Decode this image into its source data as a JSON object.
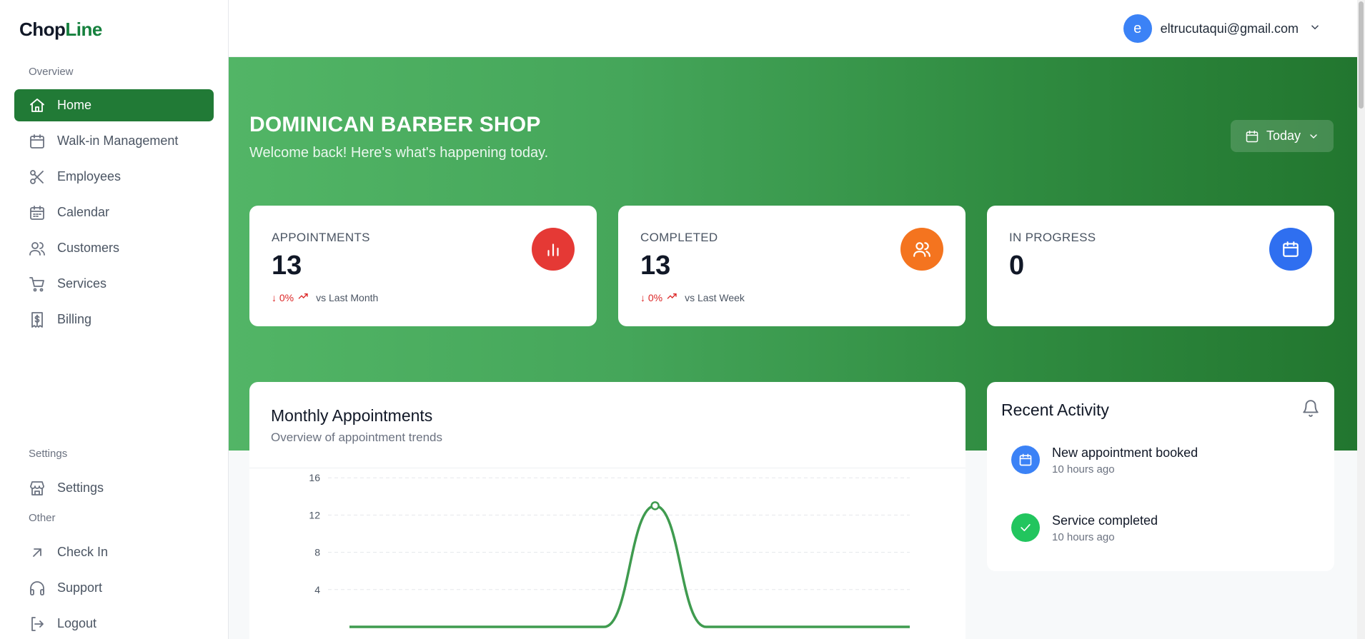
{
  "brand": {
    "part1": "Chop",
    "part2": "Line"
  },
  "sidebar": {
    "overview_label": "Overview",
    "items": [
      {
        "label": "Home",
        "icon": "home-icon"
      },
      {
        "label": "Walk-in Management",
        "icon": "calendar-icon"
      },
      {
        "label": "Employees",
        "icon": "scissors-icon"
      },
      {
        "label": "Calendar",
        "icon": "calendar-days-icon"
      },
      {
        "label": "Customers",
        "icon": "users-icon"
      },
      {
        "label": "Services",
        "icon": "cart-icon"
      },
      {
        "label": "Billing",
        "icon": "receipt-dollar-icon"
      }
    ],
    "settings_label": "Settings",
    "settings_items": [
      {
        "label": "Settings",
        "icon": "store-icon"
      }
    ],
    "other_label": "Other",
    "other_items": [
      {
        "label": "Check In",
        "icon": "arrow-up-right-icon"
      },
      {
        "label": "Support",
        "icon": "headphones-icon"
      },
      {
        "label": "Logout",
        "icon": "logout-icon"
      }
    ]
  },
  "user": {
    "initial": "e",
    "email": "eltrucutaqui@gmail.com"
  },
  "hero": {
    "title": "DOMINICAN BARBER SHOP",
    "subtitle": "Welcome back! Here's what's happening today.",
    "period_button": "Today"
  },
  "stats": [
    {
      "label": "APPOINTMENTS",
      "value": "13",
      "change": "↓ 0%",
      "compare": "vs Last Month",
      "color": "#e53935",
      "icon": "bar-chart-icon"
    },
    {
      "label": "COMPLETED",
      "value": "13",
      "change": "↓ 0%",
      "compare": "vs Last Week",
      "color": "#f4741f",
      "icon": "users-icon"
    },
    {
      "label": "IN PROGRESS",
      "value": "0",
      "color": "#2f6ff0",
      "icon": "calendar-icon"
    }
  ],
  "chart": {
    "title": "Monthly Appointments",
    "subtitle": "Overview of appointment trends"
  },
  "chart_data": {
    "type": "line",
    "title": "Monthly Appointments",
    "y_ticks": [
      4,
      8,
      12,
      16
    ],
    "ylim": [
      0,
      16
    ],
    "x": [
      0,
      1,
      2,
      3,
      4,
      5,
      6,
      7,
      8,
      9,
      10,
      11
    ],
    "series": [
      {
        "values": [
          0,
          0,
          0,
          0,
          0,
          0,
          13,
          0,
          0,
          0,
          0,
          0
        ],
        "color": "#3f9b4f"
      }
    ],
    "grid": true
  },
  "activity": {
    "title": "Recent Activity",
    "items": [
      {
        "title": "New appointment booked",
        "time": "10 hours ago",
        "color": "#3b82f6",
        "icon": "calendar-icon"
      },
      {
        "title": "Service completed",
        "time": "10 hours ago",
        "color": "#22c55e",
        "icon": "check-icon"
      }
    ]
  }
}
